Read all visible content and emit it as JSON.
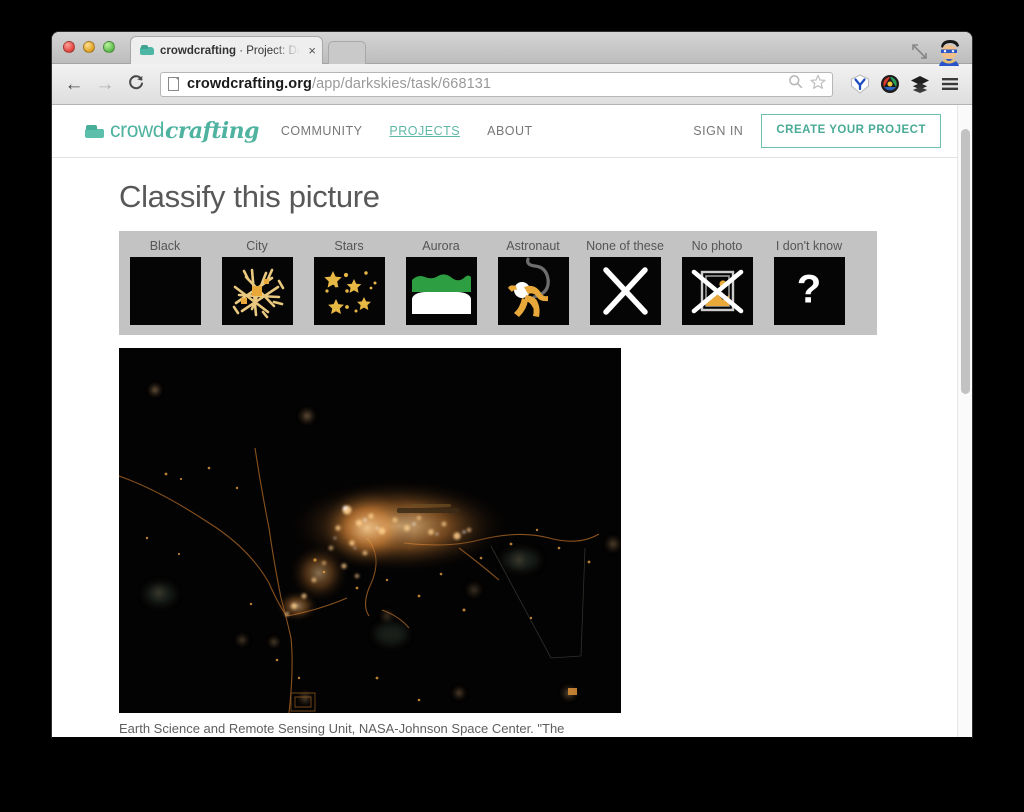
{
  "browser": {
    "tab": {
      "title_bold": "crowdcrafting",
      "title_rest": " · Project: Da",
      "close_label": "×",
      "favicon": "crowdcrafting-favicon"
    },
    "window_controls": {
      "close": "close-window",
      "minimize": "minimize-window",
      "zoom": "zoom-window"
    },
    "toolbar": {
      "back_label": "←",
      "forward_label": "→",
      "reload_label": "⟳",
      "url_host": "crowdcrafting.org",
      "url_path": "/app/darkskies/task/668131",
      "url_full": "crowdcrafting.org/app/darkskies/task/668131",
      "search_icon": "magnifier-icon",
      "bookmark_icon": "star-icon",
      "extension_1": "y-extension-icon",
      "extension_2": "color-wheel-extension-icon",
      "extension_3": "layers-extension-icon",
      "menu_icon": "hamburger-menu-icon"
    },
    "expand_icon": "fullscreen-expand-icon",
    "avatar": "user-avatar"
  },
  "site_header": {
    "logo_part1": "crowd",
    "logo_part2": "crafting",
    "nav": [
      {
        "label": "COMMUNITY",
        "active": false
      },
      {
        "label": "PROJECTS",
        "active": true
      },
      {
        "label": "ABOUT",
        "active": false
      }
    ],
    "sign_in": "SIGN IN",
    "create_project": "CREATE YOUR PROJECT"
  },
  "main": {
    "title": "Classify this picture",
    "answers": [
      {
        "label": "Black",
        "icon": "black-square-icon"
      },
      {
        "label": "City",
        "icon": "city-lights-icon"
      },
      {
        "label": "Stars",
        "icon": "stars-icon"
      },
      {
        "label": "Aurora",
        "icon": "aurora-icon"
      },
      {
        "label": "Astronaut",
        "icon": "astronaut-icon"
      },
      {
        "label": "None of these",
        "icon": "x-cross-icon"
      },
      {
        "label": "No photo",
        "icon": "no-photo-icon"
      },
      {
        "label": "I don't know",
        "icon": "question-mark-icon"
      }
    ],
    "task_image_alt": "night-satellite-photo-of-coastal-city-lights",
    "caption": "Earth Science and Remote Sensing Unit, NASA-Johnson Space Center. \"The Gateway to Astronaut Photography of Earth.\""
  },
  "colors": {
    "brand_teal": "#4fb3a0",
    "panel_gray": "#c3c3c3",
    "icon_amber": "#e8a93a",
    "aurora_green": "#2e9e43",
    "tile_black": "#050505"
  }
}
